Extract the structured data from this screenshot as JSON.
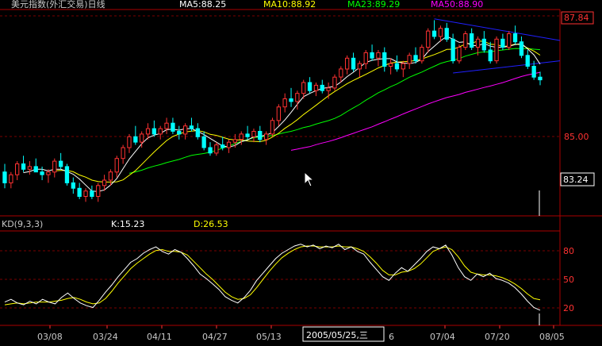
{
  "header": {
    "title": "美元指数(外汇交易)日线",
    "ma5": "MA5:88.25",
    "ma10": "MA10:88.92",
    "ma23": "MA23:89.29",
    "ma50": "MA50:88.90"
  },
  "kd_header": {
    "name": "KD(9,3,3)",
    "k": "K:15.23",
    "d": "D:26.53"
  },
  "price_axis": {
    "top_label": "87.84",
    "mid_label": "85.00",
    "current_label": "83.24"
  },
  "kd_axis": {
    "labels": [
      "80",
      "50",
      "20"
    ]
  },
  "date_axis": {
    "labels": [
      "03/08",
      "03/24",
      "04/11",
      "04/27",
      "05/13",
      "6",
      "07/04",
      "07/20",
      "08/05"
    ],
    "cursor_label": "2005/05/25,三"
  },
  "colors": {
    "up": "#ff3232",
    "down": "#00ffff",
    "ma5": "#ffffff",
    "ma10": "#ffff00",
    "ma23": "#00ff00",
    "ma50": "#ff00ff",
    "grid": "#7a0000",
    "axis_text": "#ff3232",
    "trendline": "#2020ff"
  },
  "chart_data": {
    "type": "candlestick",
    "main_ylim": [
      81.4,
      88.6
    ],
    "kd_ylim": [
      0,
      100
    ],
    "candles": [
      [
        82.9,
        83.2,
        82.3,
        82.5
      ],
      [
        82.5,
        82.9,
        82.3,
        82.8
      ],
      [
        82.8,
        83.3,
        82.6,
        83.2
      ],
      [
        83.2,
        83.5,
        82.9,
        83.0
      ],
      [
        83.0,
        83.3,
        82.8,
        83.1
      ],
      [
        83.1,
        83.4,
        82.9,
        82.9
      ],
      [
        82.9,
        83.1,
        82.6,
        82.8
      ],
      [
        82.8,
        83.0,
        82.5,
        82.9
      ],
      [
        82.9,
        83.4,
        82.7,
        83.3
      ],
      [
        83.3,
        83.6,
        83.0,
        83.1
      ],
      [
        83.1,
        83.2,
        82.4,
        82.5
      ],
      [
        82.5,
        82.7,
        82.1,
        82.3
      ],
      [
        82.3,
        82.5,
        81.9,
        82.0
      ],
      [
        82.0,
        82.3,
        81.8,
        82.2
      ],
      [
        82.2,
        82.4,
        81.9,
        82.0
      ],
      [
        82.0,
        82.5,
        81.8,
        82.4
      ],
      [
        82.4,
        82.8,
        82.2,
        82.6
      ],
      [
        82.6,
        83.0,
        82.4,
        82.9
      ],
      [
        82.9,
        83.5,
        82.7,
        83.4
      ],
      [
        83.4,
        83.9,
        83.2,
        83.8
      ],
      [
        83.8,
        84.3,
        83.6,
        84.2
      ],
      [
        84.2,
        84.6,
        83.9,
        84.0
      ],
      [
        84.0,
        84.4,
        83.8,
        84.3
      ],
      [
        84.3,
        84.7,
        84.1,
        84.5
      ],
      [
        84.5,
        84.8,
        84.2,
        84.3
      ],
      [
        84.3,
        84.6,
        84.1,
        84.5
      ],
      [
        84.5,
        84.9,
        84.3,
        84.7
      ],
      [
        84.7,
        84.9,
        84.3,
        84.4
      ],
      [
        84.4,
        84.6,
        84.1,
        84.3
      ],
      [
        84.3,
        84.7,
        84.1,
        84.6
      ],
      [
        84.6,
        84.9,
        84.4,
        84.5
      ],
      [
        84.5,
        84.7,
        84.1,
        84.2
      ],
      [
        84.2,
        84.4,
        83.7,
        83.8
      ],
      [
        83.8,
        84.0,
        83.5,
        83.6
      ],
      [
        83.6,
        84.0,
        83.5,
        83.9
      ],
      [
        83.9,
        84.2,
        83.7,
        83.8
      ],
      [
        83.8,
        84.1,
        83.6,
        84.0
      ],
      [
        84.0,
        84.3,
        83.8,
        84.1
      ],
      [
        84.1,
        84.4,
        83.9,
        84.3
      ],
      [
        84.3,
        84.6,
        84.1,
        84.2
      ],
      [
        84.2,
        84.5,
        84.0,
        84.4
      ],
      [
        84.4,
        84.6,
        84.0,
        84.1
      ],
      [
        84.1,
        84.4,
        83.9,
        84.3
      ],
      [
        84.3,
        84.9,
        84.2,
        84.8
      ],
      [
        84.8,
        85.4,
        84.6,
        85.3
      ],
      [
        85.3,
        85.8,
        85.1,
        85.6
      ],
      [
        85.6,
        86.0,
        85.3,
        85.5
      ],
      [
        85.5,
        85.9,
        85.2,
        85.8
      ],
      [
        85.8,
        86.3,
        85.6,
        86.2
      ],
      [
        86.2,
        86.4,
        85.8,
        85.9
      ],
      [
        85.9,
        86.2,
        85.7,
        86.1
      ],
      [
        86.1,
        86.3,
        85.8,
        85.9
      ],
      [
        85.9,
        86.2,
        85.6,
        86.0
      ],
      [
        86.0,
        86.5,
        85.9,
        86.4
      ],
      [
        86.4,
        86.8,
        86.2,
        86.7
      ],
      [
        86.7,
        87.2,
        86.5,
        87.1
      ],
      [
        87.1,
        87.3,
        86.6,
        86.7
      ],
      [
        86.7,
        87.0,
        86.4,
        86.9
      ],
      [
        86.9,
        87.4,
        86.7,
        87.3
      ],
      [
        87.3,
        87.6,
        87.0,
        87.1
      ],
      [
        87.1,
        87.4,
        86.8,
        87.3
      ],
      [
        87.3,
        87.5,
        86.6,
        86.8
      ],
      [
        86.8,
        87.1,
        86.5,
        86.9
      ],
      [
        86.9,
        87.2,
        86.6,
        86.7
      ],
      [
        86.7,
        87.0,
        86.4,
        86.9
      ],
      [
        86.9,
        87.3,
        86.7,
        87.2
      ],
      [
        87.2,
        87.5,
        86.9,
        87.0
      ],
      [
        87.0,
        87.6,
        86.9,
        87.5
      ],
      [
        87.5,
        88.2,
        87.3,
        88.1
      ],
      [
        88.1,
        88.5,
        87.8,
        87.9
      ],
      [
        87.9,
        88.3,
        87.7,
        88.2
      ],
      [
        88.2,
        88.4,
        87.7,
        87.8
      ],
      [
        87.8,
        88.0,
        86.9,
        87.0
      ],
      [
        87.0,
        87.6,
        86.9,
        87.5
      ],
      [
        87.5,
        88.1,
        87.4,
        88.0
      ],
      [
        88.0,
        88.2,
        87.4,
        87.5
      ],
      [
        87.5,
        87.9,
        87.2,
        87.8
      ],
      [
        87.8,
        88.1,
        87.3,
        87.4
      ],
      [
        87.4,
        87.7,
        86.9,
        87.0
      ],
      [
        87.0,
        87.9,
        86.9,
        87.8
      ],
      [
        87.8,
        88.0,
        87.4,
        87.5
      ],
      [
        87.5,
        88.1,
        87.4,
        88.0
      ],
      [
        88.0,
        88.3,
        87.6,
        87.7
      ],
      [
        87.7,
        87.9,
        87.1,
        87.2
      ],
      [
        87.2,
        87.4,
        86.7,
        86.8
      ],
      [
        86.8,
        87.0,
        86.3,
        86.4
      ],
      [
        86.4,
        86.6,
        86.1,
        86.3
      ]
    ],
    "k_values": [
      24,
      27,
      23,
      21,
      25,
      22,
      27,
      24,
      22,
      29,
      34,
      28,
      23,
      20,
      18,
      26,
      35,
      43,
      52,
      60,
      68,
      72,
      78,
      82,
      85,
      80,
      77,
      82,
      79,
      72,
      64,
      55,
      50,
      44,
      38,
      30,
      26,
      23,
      29,
      37,
      48,
      56,
      64,
      72,
      78,
      82,
      86,
      88,
      85,
      87,
      83,
      86,
      84,
      88,
      82,
      85,
      80,
      77,
      68,
      60,
      52,
      48,
      56,
      62,
      58,
      65,
      72,
      80,
      85,
      83,
      87,
      76,
      62,
      52,
      48,
      55,
      52,
      56,
      50,
      48,
      45,
      40,
      33,
      25,
      18,
      15
    ],
    "d_values": [
      21,
      22,
      23,
      22,
      23,
      24,
      24,
      24,
      25,
      26,
      28,
      29,
      27,
      24,
      22,
      23,
      28,
      36,
      45,
      53,
      61,
      67,
      72,
      77,
      81,
      82,
      80,
      80,
      79,
      76,
      69,
      62,
      55,
      49,
      42,
      35,
      30,
      27,
      28,
      32,
      40,
      49,
      58,
      66,
      73,
      78,
      82,
      85,
      86,
      86,
      85,
      85,
      85,
      86,
      85,
      85,
      83,
      80,
      74,
      67,
      59,
      54,
      54,
      57,
      58,
      61,
      66,
      73,
      80,
      83,
      85,
      82,
      74,
      64,
      57,
      55,
      54,
      54,
      53,
      51,
      48,
      44,
      39,
      33,
      28,
      26.5
    ]
  }
}
